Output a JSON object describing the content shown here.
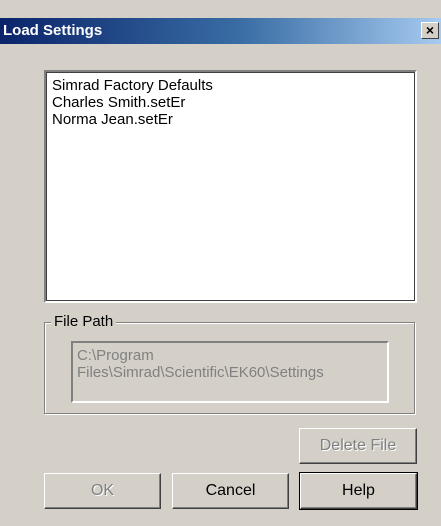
{
  "window": {
    "title": "Load Settings",
    "close_symbol": "×"
  },
  "settings_list": {
    "items": [
      {
        "label": "Simrad Factory Defaults"
      },
      {
        "label": "Charles Smith.setEr"
      },
      {
        "label": "Norma Jean.setEr"
      }
    ]
  },
  "file_path": {
    "group_label": "File Path",
    "line1": "C:\\Program",
    "line2": "Files\\Simrad\\Scientific\\EK60\\Settings"
  },
  "buttons": {
    "delete_label": "Delete File",
    "ok_label": "OK",
    "cancel_label": "Cancel",
    "help_label": "Help"
  }
}
